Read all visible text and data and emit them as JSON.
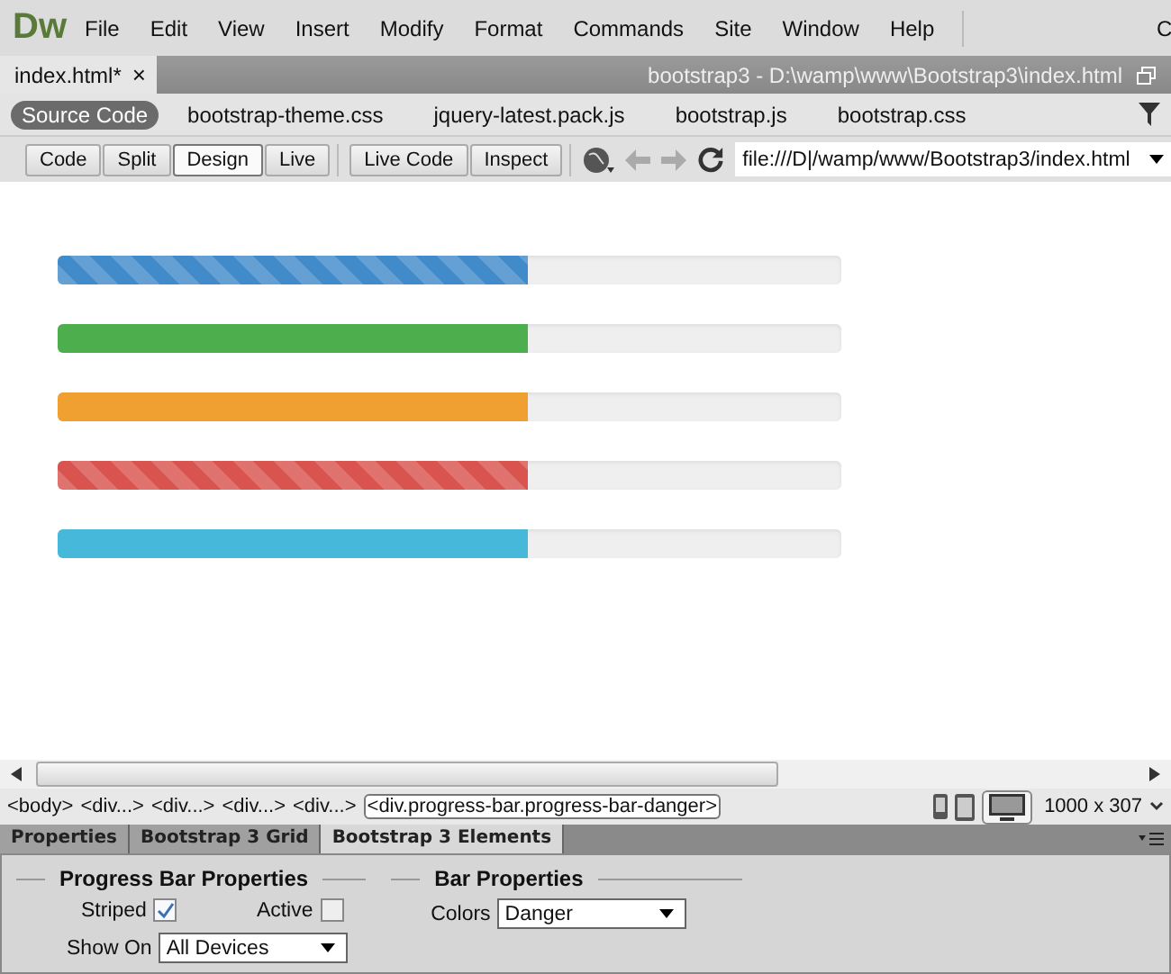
{
  "app_logo": "Dw",
  "menu": [
    "File",
    "Edit",
    "View",
    "Insert",
    "Modify",
    "Format",
    "Commands",
    "Site",
    "Window",
    "Help"
  ],
  "menu_cut": "C",
  "document_tab": {
    "label": "index.html*",
    "close": "×"
  },
  "document_path": "bootstrap3 - D:\\wamp\\www\\Bootstrap3\\index.html",
  "related_files": [
    {
      "label": "Source Code",
      "selected": true
    },
    {
      "label": "bootstrap-theme.css",
      "selected": false
    },
    {
      "label": "jquery-latest.pack.js",
      "selected": false
    },
    {
      "label": "bootstrap.js",
      "selected": false
    },
    {
      "label": "bootstrap.css",
      "selected": false
    }
  ],
  "view_buttons": [
    {
      "label": "Code",
      "selected": false
    },
    {
      "label": "Split",
      "selected": false
    },
    {
      "label": "Design",
      "selected": true
    },
    {
      "label": "Live",
      "selected": false
    }
  ],
  "live_buttons": [
    "Live Code",
    "Inspect"
  ],
  "address": "file:///D|/wamp/www/Bootstrap3/index.html",
  "progress_bars": [
    {
      "color": "#428bca",
      "striped": true,
      "level": 0.6
    },
    {
      "color": "#4cae4c",
      "striped": false,
      "level": 0.6
    },
    {
      "color": "#f0a030",
      "striped": false,
      "level": 0.6
    },
    {
      "color": "#d9534f",
      "striped": true,
      "level": 0.6
    },
    {
      "color": "#46b8da",
      "striped": false,
      "level": 0.6
    }
  ],
  "tag_selector": [
    {
      "label": "<body>",
      "selected": false
    },
    {
      "label": "<div...>",
      "selected": false
    },
    {
      "label": "<div...>",
      "selected": false
    },
    {
      "label": "<div...>",
      "selected": false
    },
    {
      "label": "<div...>",
      "selected": false
    },
    {
      "label": "<div.progress-bar.progress-bar-danger>",
      "selected": true
    }
  ],
  "window_size": "1000 x 307",
  "panel_tabs": [
    {
      "label": "Properties",
      "selected": false
    },
    {
      "label": "Bootstrap 3 Grid",
      "selected": false
    },
    {
      "label": "Bootstrap 3 Elements",
      "selected": true
    }
  ],
  "progress_section": {
    "title": "Progress Bar Properties",
    "striped": {
      "label": "Striped",
      "checked": true
    },
    "active": {
      "label": "Active",
      "checked": false
    },
    "show_on": {
      "label": "Show On",
      "value": "All Devices"
    }
  },
  "bar_section": {
    "title": "Bar Properties",
    "colors": {
      "label": "Colors",
      "value": "Danger"
    }
  }
}
